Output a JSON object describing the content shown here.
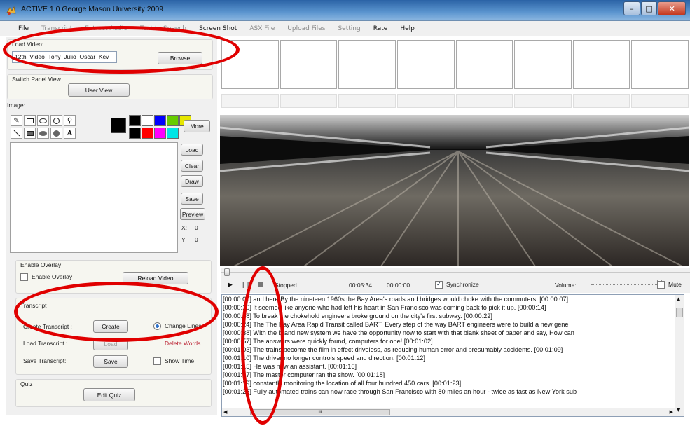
{
  "window": {
    "title": "ACTIVE 1.0 George Mason University 2009"
  },
  "menu": {
    "items": [
      {
        "label": "File",
        "enabled": true
      },
      {
        "label": "Transcript",
        "enabled": false
      },
      {
        "label": "Extract Audio",
        "enabled": false
      },
      {
        "label": "Text to Speech",
        "enabled": false
      },
      {
        "label": "Screen Shot",
        "enabled": true
      },
      {
        "label": "ASX File",
        "enabled": false
      },
      {
        "label": "Upload Files",
        "enabled": false
      },
      {
        "label": "Setting",
        "enabled": false
      },
      {
        "label": "Rate",
        "enabled": true
      },
      {
        "label": "Help",
        "enabled": true
      }
    ]
  },
  "load_video": {
    "label": "Load Video:",
    "value": "12th_Video_Tony_Julio_Oscar_Kev",
    "browse": "Browse"
  },
  "switch_panel": {
    "label": "Switch Panel View",
    "button": "User View"
  },
  "image": {
    "label": "Image:",
    "more": "More",
    "colors_top": [
      "#000000",
      "#ffffff",
      "#0000ff",
      "#66cc00",
      "#e6e600"
    ],
    "colors_bottom": [
      "#000000",
      "#ff0000",
      "#ff00ff",
      "#00e6e6"
    ],
    "load": "Load",
    "clear": "Clear",
    "draw": "Draw",
    "save": "Save",
    "preview": "Preview",
    "x_label": "X:",
    "x_value": "0",
    "y_label": "Y:",
    "y_value": "0"
  },
  "overlay": {
    "group": "Enable Overlay",
    "checkbox": "Enable Overlay",
    "reload": "Reload Video"
  },
  "transcript": {
    "group": "Transcript",
    "create_label": "Create Transcript :",
    "create_btn": "Create",
    "load_label": "Load Transcript :",
    "load_btn": "Load",
    "save_label": "Save Transcript:",
    "save_btn": "Save",
    "change_lines": "Change Lines",
    "delete_words": "Delete Words",
    "show_time": "Show Time"
  },
  "quiz": {
    "group": "Quiz",
    "button": "Edit Quiz"
  },
  "player": {
    "status": "Stopped",
    "position": "00:05:34",
    "duration": "00:00:00",
    "sync": "Synchronize",
    "volume": "Volume:",
    "mute": "Mute",
    "play": "▶",
    "pause": "❙❙",
    "stop": "■"
  },
  "transcript_lines": [
    "[00:00:00] and here By the nineteen 1960s the Bay Area's roads and bridges would choke with the commuters. [00:00:07]",
    "[00:00:10] It seemed like anyone who had left his heart in San Francisco was coming back to pick it up. [00:00:14]",
    "[00:00:18] To break the chokehold engineers broke ground on the city's first subway. [00:00:22]",
    "[00:00:24] The The Bay Area Rapid Transit called BART. Every step of the way BART engineers were to build a new gene",
    "[00:00:38] With the brand new system we have the opportunity now to start with that blank sheet of paper and say, How can",
    "[00:00:57] The answers were quickly found, computers for one! [00:01:02]",
    "[00:01:03] The trains become the film in effect driveless, as reducing human error and presumably accidents. [00:01:09]",
    "[00:01:10] The driver no longer controls speed and direction. [00:01:12]",
    "[00:01:15] He was now an assistant. [00:01:16]",
    "[00:01:17] The master computer ran the show. [00:01:18]",
    "[00:01:19] constantly monitoring the location of all four hundred 450 cars. [00:01:23]",
    "[00:01:25] Fully automated trains can now race through San Francisco with 80 miles an hour - twice as fast as New York sub"
  ],
  "hscroll_thumb": "III",
  "annotations": {
    "highlight_color": "#e00000"
  }
}
